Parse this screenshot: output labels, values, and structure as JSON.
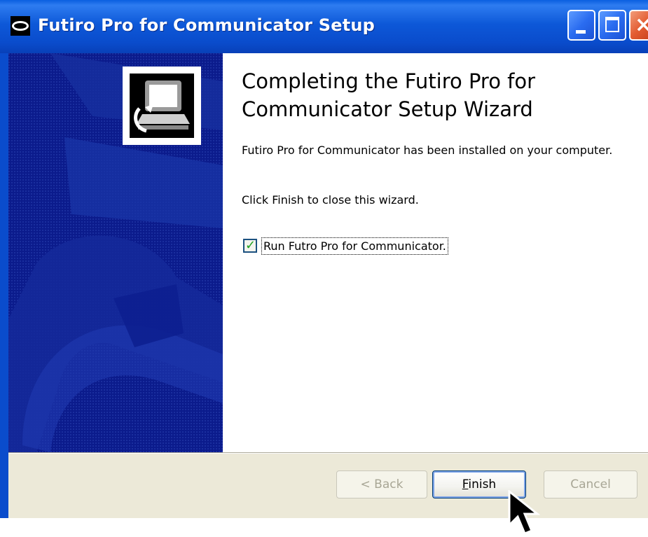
{
  "window": {
    "title": "Futiro Pro for Communicator Setup"
  },
  "wizard": {
    "heading": "Completing the Futiro Pro for Communicator Setup Wizard",
    "installed_message": "Futiro Pro for Communicator has been installed on your computer.",
    "finish_instruction": "Click Finish to close this wizard.",
    "run_option": {
      "label": "Run Futro Pro for Communicator.",
      "checked": true
    }
  },
  "buttons": {
    "back_label": "< Back",
    "finish_label_first": "F",
    "finish_label_rest": "inish",
    "cancel_label": "Cancel"
  },
  "colors": {
    "sidebar_background": "#0b1b8c",
    "titlebar": "#0a4ccc",
    "checkmark": "#21a121"
  },
  "icons": {
    "title_icon": "app-icon",
    "app_logo": "computer-icon",
    "cursor": "mouse-pointer-icon"
  }
}
